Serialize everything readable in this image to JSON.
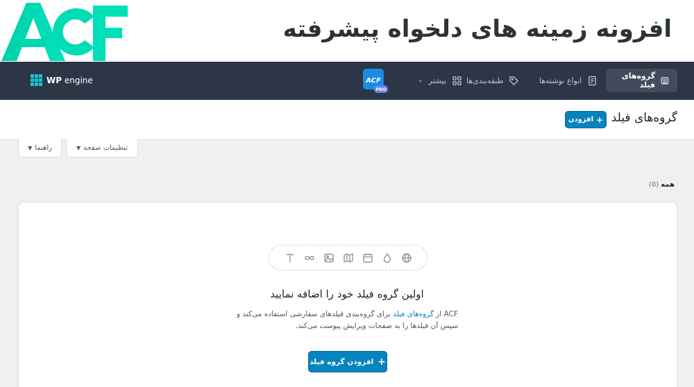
{
  "banner": {
    "logo_text": "ACF",
    "title": "افزونه زمینه های دلخواه پیشرفته"
  },
  "topnav": {
    "brand_bold": "WP",
    "brand_rest": "engine",
    "items": [
      {
        "label": "گروه‌های فیلد",
        "icon": "list-icon",
        "active": true
      },
      {
        "label": "انواع نوشته‌ها",
        "icon": "document-icon",
        "active": false
      },
      {
        "label": "طبقه‌بندی‌ها",
        "icon": "tag-icon",
        "active": false
      },
      {
        "label": "بیشتر",
        "icon": "grid-icon",
        "active": false
      }
    ],
    "pro_badge": "PRO",
    "acf_badge": "ACF"
  },
  "header": {
    "title": "گروه‌های فیلد",
    "add_label": "افزودن"
  },
  "screen_tabs": {
    "screen_options": "تنظیمات صفحه",
    "help": "راهنما"
  },
  "filter": {
    "all_label": "همه",
    "count": "(0)"
  },
  "empty_state": {
    "field_type_icons": [
      "text-icon",
      "infinity-icon",
      "image-icon",
      "map-icon",
      "calendar-icon",
      "color-drop-icon",
      "globe-icon"
    ],
    "title": "اولین گروه فیلد خود را اضافه نمایید",
    "desc_pre": "ACF از",
    "desc_link": "گروه‌های فیلد",
    "desc_post": "برای گروه‌بندی فیلدهای سفارشی استفاده می‌کند و سپس آن فیلدها را به صفحات ویرایش پیوست می‌کند.",
    "cta_label": "افزودن گروه فیلد"
  },
  "colors": {
    "accent": "#0783be",
    "nav_bg": "#2d3646",
    "acf_green": "#00d7a5"
  }
}
